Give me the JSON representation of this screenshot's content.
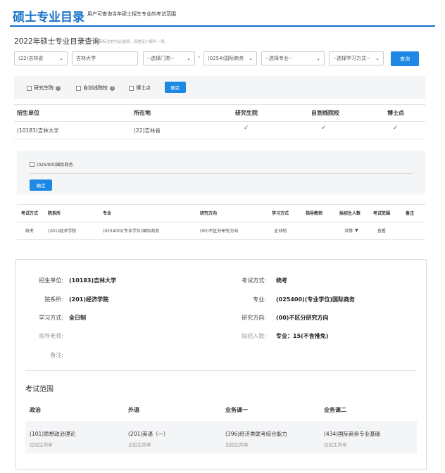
{
  "header": {
    "title": "硕士专业目录",
    "subtitle": "用户可查询当年硕士招生专业的考试范围"
  },
  "search": {
    "title": "2022年硕士专业目录查询",
    "hint": "带标注的为必选项，其他至少填写一项。",
    "province": "(22)吉林省",
    "school": "吉林大学",
    "category": "--选择门类--",
    "discipline": "(0254)国际商务",
    "major": "--选择专业--",
    "study_mode": "--选择学习方式--",
    "query_label": "查询"
  },
  "filters": {
    "grad_school": "研究生院",
    "self_line": "自划线院校",
    "doctorate": "博士点",
    "confirm_label": "确定"
  },
  "school_table": {
    "headers": [
      "招生单位",
      "所在地",
      "研究生院",
      "自划线院校",
      "博士点"
    ],
    "row": {
      "unit": "(10183)吉林大学",
      "location": "(22)吉林省"
    }
  },
  "major_filter": {
    "option": "(025400)国际商务",
    "confirm_label": "确定"
  },
  "major_table": {
    "headers": [
      "考试方式",
      "院系所",
      "专业",
      "研究方向",
      "学习方式",
      "指导教师",
      "拟招生人数",
      "考试范围",
      "备注"
    ],
    "row": {
      "exam_mode": "统考",
      "department": "(201)经济学院",
      "major": "(025400)(专业学位)国际商务",
      "direction": "(00)不区分研究方向",
      "study_mode": "全日制",
      "enrollment": "详情",
      "scope": "查看"
    }
  },
  "detail": {
    "labels": {
      "unit": "招生单位:",
      "exam_mode": "考试方式:",
      "department": "院系所:",
      "major": "专业:",
      "study_mode": "学习方式:",
      "direction": "研究方向:",
      "advisor": "指导老师:",
      "enrollment": "拟招人数:",
      "remarks": "备注:"
    },
    "values": {
      "unit": "(10183)吉林大学",
      "exam_mode": "统考",
      "department": "(201)经济学院",
      "major": "(025400)(专业学位)国际商务",
      "study_mode": "全日制",
      "direction": "(00)不区分研究方向",
      "enrollment": "专业：15(不含推免)"
    }
  },
  "exam_scope": {
    "title": "考试范围",
    "headers": [
      "政治",
      "外语",
      "业务课一",
      "业务课二"
    ],
    "subjects": [
      "(101)思想政治理论",
      "(201)英语（一）",
      "(396)经济类联考综合能力",
      "(434)国际商务专业基础"
    ],
    "link": "见招生简章"
  }
}
